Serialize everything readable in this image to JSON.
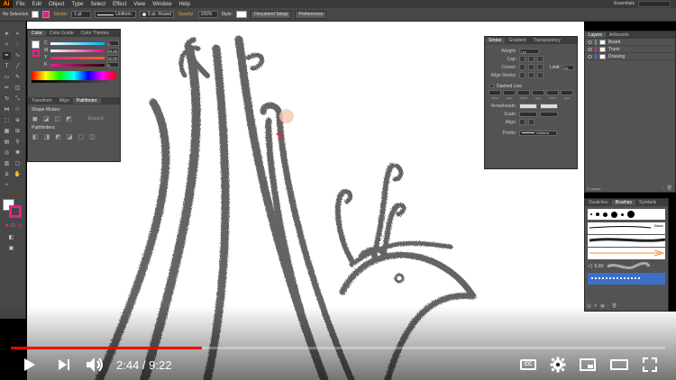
{
  "app": {
    "logo": "Ai",
    "menu": [
      "File",
      "Edit",
      "Object",
      "Type",
      "Select",
      "Effect",
      "View",
      "Window",
      "Help"
    ],
    "workspace": "Essentials"
  },
  "control_bar": {
    "selection": "No Selection",
    "stroke_label": "Stroke:",
    "stroke_value": "1 pt",
    "profile": "Uniform",
    "brush": "5 pt. Round",
    "opacity_label": "Opacity:",
    "opacity_value": "100%",
    "style_label": "Style:",
    "doc_setup": "Document Setup",
    "preferences": "Preferences"
  },
  "color_panel": {
    "tabs": [
      "Color",
      "Color Guide",
      "Color Themes"
    ],
    "channels": [
      {
        "name": "C",
        "value": "0"
      },
      {
        "name": "M",
        "value": "94.08"
      },
      {
        "name": "Y",
        "value": "10.99"
      },
      {
        "name": "K",
        "value": "0"
      }
    ]
  },
  "pathfinder_panel": {
    "tabs": [
      "Transform",
      "Align",
      "Pathfinder"
    ],
    "shape_modes": "Shape Modes:",
    "expand": "Expand",
    "pathfinders": "Pathfinders:"
  },
  "stroke_panel": {
    "tabs": [
      "Stroke",
      "Gradient",
      "Transparency"
    ],
    "weight_label": "Weight:",
    "weight_value": "1 pt",
    "cap_label": "Cap:",
    "corner_label": "Corner:",
    "limit_label": "Limit:",
    "limit_value": "10",
    "align_label": "Align Stroke:",
    "dashed": "Dashed Line",
    "dash_labels": [
      "dash",
      "gap",
      "dash",
      "gap",
      "dash",
      "gap"
    ],
    "arrowheads_label": "Arrowheads:",
    "scale_label": "Scale:",
    "align2_label": "Align:",
    "profile_label": "Profile:",
    "profile_value": "Uniform"
  },
  "layers_panel": {
    "tabs": [
      "Layers",
      "Artboards"
    ],
    "layers": [
      {
        "name": "Board",
        "color": "#4caf50"
      },
      {
        "name": "Trunk",
        "color": "#e91e8c"
      },
      {
        "name": "Drawing",
        "color": "#3f6fd8"
      }
    ],
    "count": "3 Layers"
  },
  "brushes_panel": {
    "tabs": [
      "Swatches",
      "Brushes",
      "Symbols"
    ],
    "basic": "Basic",
    "size": "6.00"
  },
  "player": {
    "current": "2:44",
    "duration": "9:22",
    "time_display": "2:44 / 9:22",
    "progress": 0.2918,
    "cc_label": "CC"
  }
}
